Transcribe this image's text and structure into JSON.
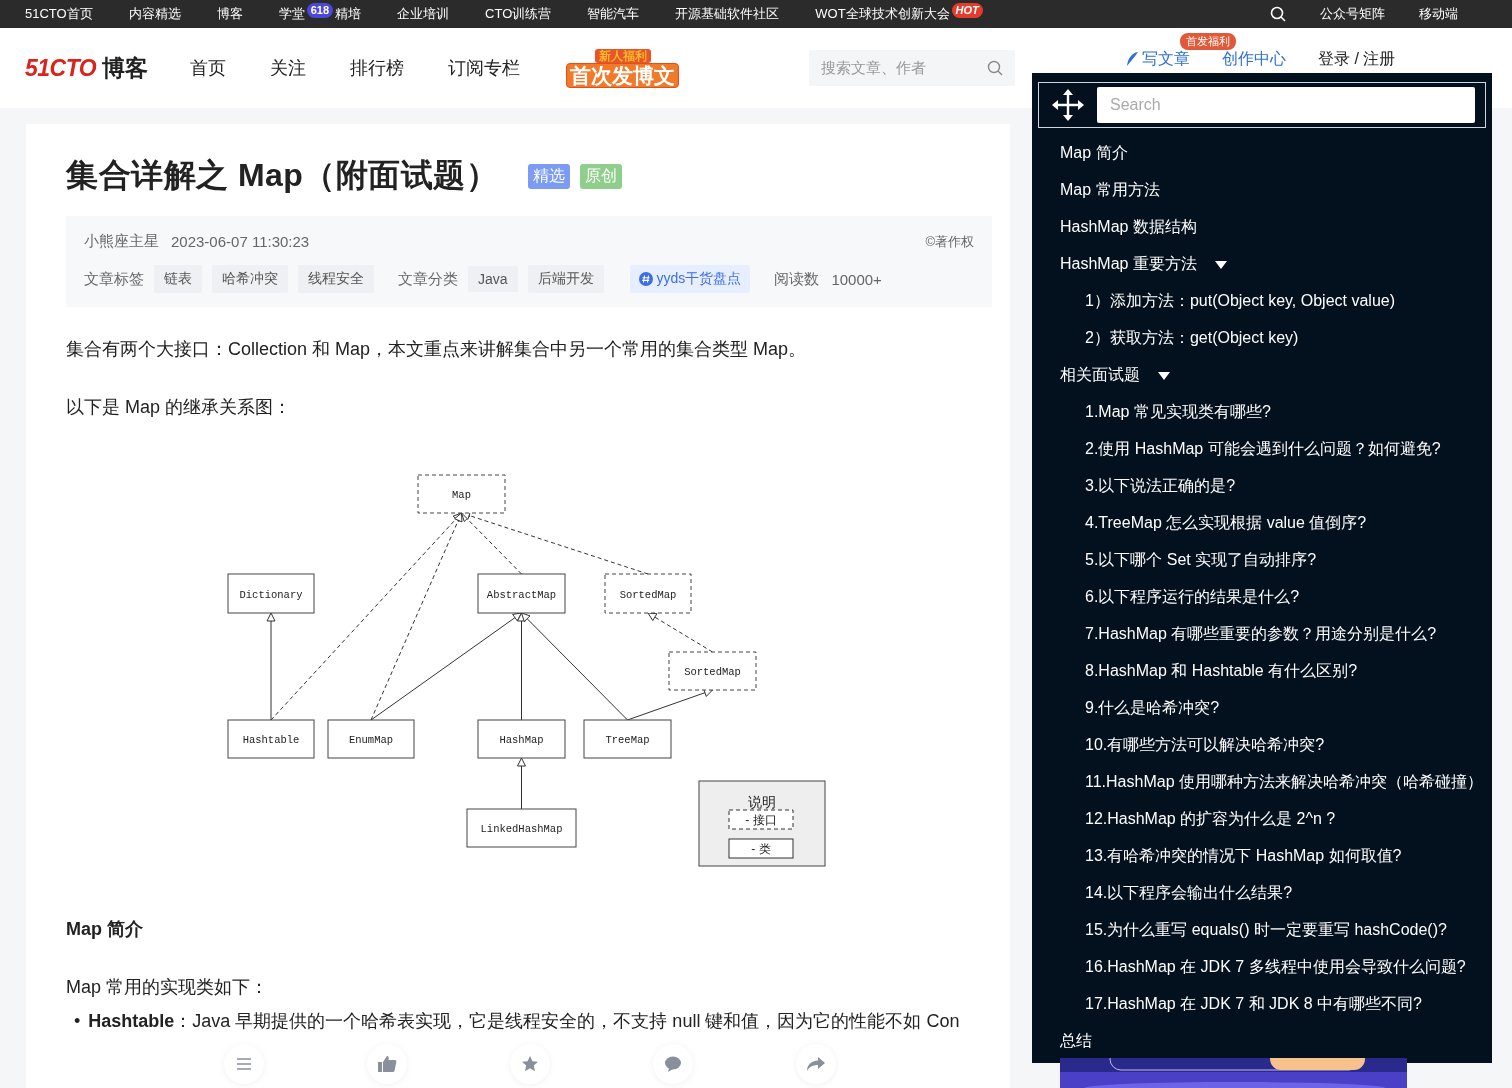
{
  "top_nav": {
    "items": [
      {
        "label": "51CTO首页"
      },
      {
        "label": "内容精选"
      },
      {
        "label": "博客"
      },
      {
        "label": "学堂",
        "badge": "618",
        "suffix": "精培"
      },
      {
        "label": "企业培训"
      },
      {
        "label": "CTO训练营"
      },
      {
        "label": "智能汽车"
      },
      {
        "label": "开源基础软件社区"
      },
      {
        "label": "WOT全球技术创新大会",
        "badge": "HOT"
      }
    ],
    "right": [
      "公众号矩阵",
      "移动端"
    ]
  },
  "header": {
    "logo": {
      "brand": "51CTO",
      "product": "博客"
    },
    "nav": [
      "首页",
      "关注",
      "排行榜",
      "订阅专栏"
    ],
    "promo": {
      "top": "新人福利",
      "main": "首次发博文"
    },
    "search": {
      "placeholder": "搜索文章、作者"
    },
    "write": "写文章",
    "write_badge": "首发福利",
    "creator": "创作中心",
    "login": "登录 / 注册"
  },
  "article": {
    "title": "集合详解之 Map（附面试题）",
    "badges": [
      {
        "label": "精选",
        "color": "#7b9cf2"
      },
      {
        "label": "原创",
        "color": "#8fcf8b"
      }
    ],
    "meta": {
      "author": "小熊座主星",
      "date": "2023-06-07 11:30:23",
      "copyright": "©著作权",
      "tags_label": "文章标签",
      "tags": [
        "链表",
        "哈希冲突",
        "线程安全"
      ],
      "category_label": "文章分类",
      "categories": [
        "Java",
        "后端开发"
      ],
      "topic": "yyds干货盘点",
      "reads_label": "阅读数",
      "reads": "10000+"
    },
    "intro": [
      "集合有两个大接口：Collection 和 Map，本文重点来讲解集合中另一个常用的集合类型 Map。",
      "以下是 Map 的继承关系图："
    ],
    "diagram": {
      "nodes": [
        {
          "label": "Map",
          "kind": "interface"
        },
        {
          "label": "Dictionary",
          "kind": "class"
        },
        {
          "label": "AbstractMap",
          "kind": "class"
        },
        {
          "label": "SortedMap",
          "kind": "interface"
        },
        {
          "label": "SortedMap",
          "kind": "interface"
        },
        {
          "label": "Hashtable",
          "kind": "class"
        },
        {
          "label": "EnumMap",
          "kind": "class"
        },
        {
          "label": "HashMap",
          "kind": "class"
        },
        {
          "label": "TreeMap",
          "kind": "class"
        },
        {
          "label": "LinkedHashMap",
          "kind": "class"
        }
      ],
      "legend": {
        "title": "说明",
        "items": [
          {
            "label": "- 接口",
            "kind": "interface"
          },
          {
            "label": "- 类",
            "kind": "class"
          }
        ]
      }
    },
    "section_heading": "Map 简介",
    "section_text": "Map 常用的实现类如下：",
    "bullet_marker": "•",
    "bullet": "**Hashtable**：Java 早期提供的一个哈希表实现，它是线程安全的，不支持 null 键和值，因为它的性能不如 Con"
  },
  "toc": {
    "search": {
      "placeholder": "Search"
    },
    "items": [
      {
        "label": "Map 简介"
      },
      {
        "label": "Map 常用方法"
      },
      {
        "label": "HashMap 数据结构"
      },
      {
        "label": "HashMap 重要方法",
        "expanded": true,
        "children": [
          {
            "label": "1）添加方法：put(Object key, Object value)"
          },
          {
            "label": "2）获取方法：get(Object key)"
          }
        ]
      },
      {
        "label": "相关面试题",
        "expanded": true,
        "children": [
          {
            "label": "1.Map 常见实现类有哪些?"
          },
          {
            "label": "2.使用 HashMap 可能会遇到什么问题？如何避免?"
          },
          {
            "label": "3.以下说法正确的是?"
          },
          {
            "label": "4.TreeMap 怎么实现根据 value 值倒序?"
          },
          {
            "label": "5.以下哪个 Set 实现了自动排序?"
          },
          {
            "label": "6.以下程序运行的结果是什么?"
          },
          {
            "label": "7.HashMap 有哪些重要的参数？用途分别是什么?"
          },
          {
            "label": "8.HashMap 和 Hashtable 有什么区别?"
          },
          {
            "label": "9.什么是哈希冲突?"
          },
          {
            "label": "10.有哪些方法可以解决哈希冲突?"
          },
          {
            "label": "11.HashMap 使用哪种方法来解决哈希冲突（哈希碰撞）"
          },
          {
            "label": "12.HashMap 的扩容为什么是 2^n ?"
          },
          {
            "label": "13.有哈希冲突的情况下 HashMap 如何取值?"
          },
          {
            "label": "14.以下程序会输出什么结果?"
          },
          {
            "label": "15.为什么重写 equals() 时一定要重写 hashCode()?"
          },
          {
            "label": "16.HashMap 在 JDK 7 多线程中使用会导致什么问题?"
          },
          {
            "label": "17.HashMap 在 JDK 7 和 JDK 8 中有哪些不同?"
          }
        ]
      },
      {
        "label": "总结"
      }
    ]
  }
}
